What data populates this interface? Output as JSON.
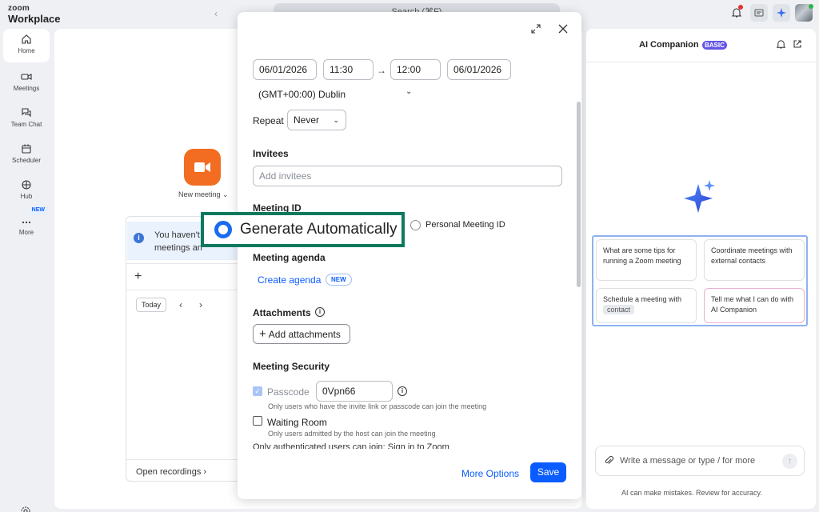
{
  "app": {
    "logo_top": "zoom",
    "logo_bottom": "Workplace"
  },
  "topbar": {
    "search_text": "Search (⌘F)"
  },
  "sidebar": {
    "items": [
      {
        "label": "Home",
        "icon": "home-icon"
      },
      {
        "label": "Meetings",
        "icon": "video-icon"
      },
      {
        "label": "Team Chat",
        "icon": "chat-icon"
      },
      {
        "label": "Scheduler",
        "icon": "calendar-icon"
      },
      {
        "label": "Hub",
        "icon": "hub-icon"
      },
      {
        "label": "More",
        "icon": "more-icon",
        "badge": "NEW"
      }
    ]
  },
  "home": {
    "new_meeting_label": "New meeting",
    "info_line1": "You haven't",
    "info_line2": "meetings an",
    "today_label": "Today",
    "open_recordings": "Open recordings"
  },
  "schedule": {
    "start_date": "06/01/2026",
    "start_time": "11:30",
    "end_time": "12:00",
    "end_date": "06/01/2026",
    "timezone": "(GMT+00:00) Dublin",
    "repeat_label": "Repeat",
    "repeat_value": "Never",
    "invitees_title": "Invitees",
    "invitees_placeholder": "Add invitees",
    "meeting_id_title": "Meeting ID",
    "generate_auto": "Generate Automatically",
    "personal_id": "Personal Meeting ID",
    "agenda_title": "Meeting agenda",
    "create_agenda": "Create agenda",
    "agenda_badge": "NEW",
    "attachments_title": "Attachments",
    "add_attachments": "Add attachments",
    "security_title": "Meeting Security",
    "passcode_label": "Passcode",
    "passcode_value": "0Vpn66",
    "passcode_hint": "Only users who have the invite link or passcode can join the meeting",
    "waiting_room_label": "Waiting Room",
    "waiting_room_hint": "Only users admitted by the host can join the meeting",
    "cut_off_text": "Only authenticated users can join: Sign in to Zoom",
    "more_options": "More Options",
    "save": "Save"
  },
  "ai": {
    "title": "AI Companion",
    "badge": "BASIC",
    "suggestions": [
      "What are some tips for running a Zoom meeting",
      "Coordinate meetings with external contacts",
      "Schedule a meeting with",
      "Tell me what I can do with AI Companion"
    ],
    "contact_pill": "contact",
    "input_placeholder": "Write a message or type / for more",
    "disclaimer": "AI can make mistakes. Review for accuracy."
  },
  "colors": {
    "accent": "#0b5cff",
    "highlight_border": "#0d7a5f",
    "new_meeting_orange": "#f26d21",
    "basic_purple": "#6356e5"
  }
}
